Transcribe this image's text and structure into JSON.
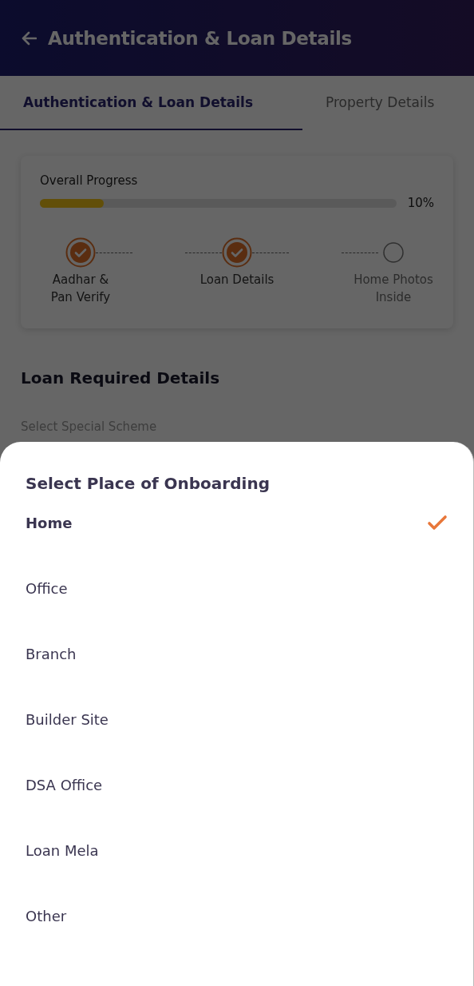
{
  "header": {
    "title": "Authentication & Loan Details"
  },
  "tabs": [
    {
      "label": "Authentication & Loan Details",
      "selected": true
    },
    {
      "label": "Property Details",
      "selected": false
    }
  ],
  "progress": {
    "label": "Overall Progress",
    "level": 0.18,
    "reading": "10%"
  },
  "steps": [
    {
      "label": "Aadhar &\nPan Verify",
      "done": true
    },
    {
      "label": "Loan Details",
      "done": true
    },
    {
      "label": "Home Photos\nInside",
      "done": false
    }
  ],
  "section": {
    "title": "Loan Required Details",
    "field_label": "Select Special Scheme"
  },
  "sheet": {
    "title": "Select Place of Onboarding",
    "options": [
      {
        "label": "Home",
        "selected": true
      },
      {
        "label": "Office",
        "selected": false
      },
      {
        "label": "Branch",
        "selected": false
      },
      {
        "label": "Builder Site",
        "selected": false
      },
      {
        "label": "DSA Office",
        "selected": false
      },
      {
        "label": "Loan Mela",
        "selected": false
      },
      {
        "label": "Other",
        "selected": false
      }
    ]
  }
}
